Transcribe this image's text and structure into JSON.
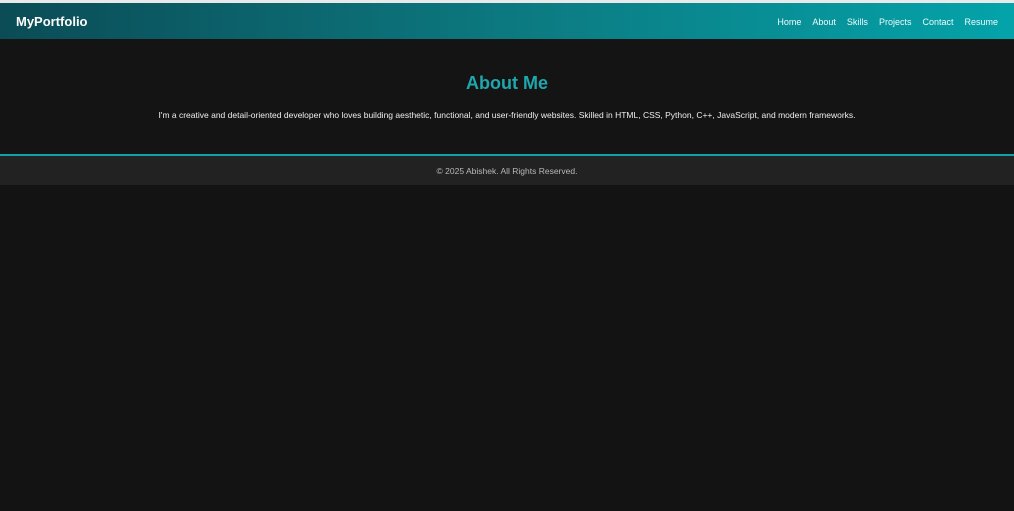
{
  "nav": {
    "brand": "MyPortfolio",
    "links": [
      "Home",
      "About",
      "Skills",
      "Projects",
      "Contact",
      "Resume"
    ]
  },
  "about": {
    "title": "About Me",
    "text": "I'm a creative and detail-oriented developer who loves building aesthetic, functional, and user-friendly websites. Skilled in HTML, CSS, Python, C++, JavaScript, and modern frameworks."
  },
  "footer": {
    "copyright": "© 2025 Abishek. All Rights Reserved."
  },
  "colors": {
    "accent": "#1fa7ad",
    "background": "#131313",
    "footer": "#222222"
  }
}
